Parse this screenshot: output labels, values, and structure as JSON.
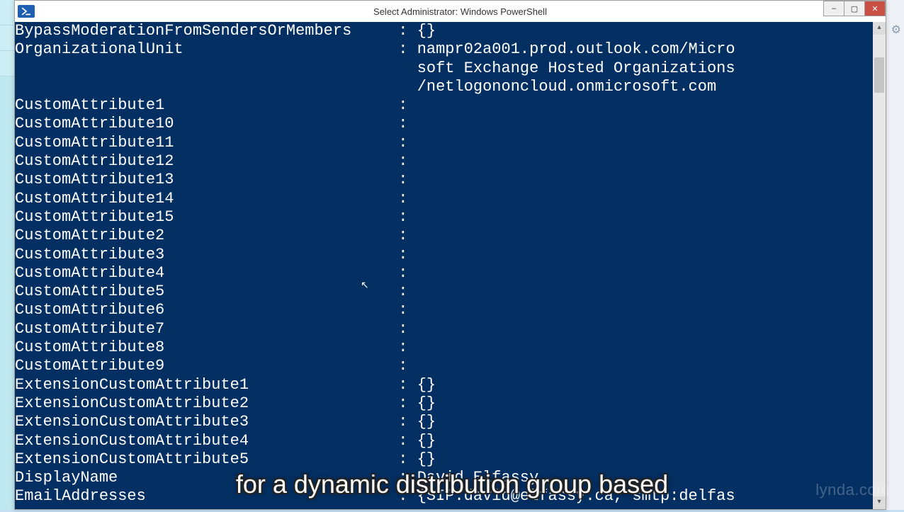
{
  "window": {
    "title": "Select Administrator: Windows PowerShell",
    "icon": "powershell-icon",
    "controls": {
      "minimize": "–",
      "maximize": "▢",
      "close": "✕"
    }
  },
  "console_rows": [
    {
      "key": "BypassModerationFromSendersOrMembers",
      "val": "{}"
    },
    {
      "key": "OrganizationalUnit",
      "val": "nampr02a001.prod.outlook.com/Micro"
    },
    {
      "key": "",
      "val": "soft Exchange Hosted Organizations"
    },
    {
      "key": "",
      "val": "/netlogononcloud.onmicrosoft.com"
    },
    {
      "key": "CustomAttribute1",
      "val": ""
    },
    {
      "key": "CustomAttribute10",
      "val": ""
    },
    {
      "key": "CustomAttribute11",
      "val": ""
    },
    {
      "key": "CustomAttribute12",
      "val": ""
    },
    {
      "key": "CustomAttribute13",
      "val": ""
    },
    {
      "key": "CustomAttribute14",
      "val": ""
    },
    {
      "key": "CustomAttribute15",
      "val": ""
    },
    {
      "key": "CustomAttribute2",
      "val": ""
    },
    {
      "key": "CustomAttribute3",
      "val": ""
    },
    {
      "key": "CustomAttribute4",
      "val": ""
    },
    {
      "key": "CustomAttribute5",
      "val": ""
    },
    {
      "key": "CustomAttribute6",
      "val": ""
    },
    {
      "key": "CustomAttribute7",
      "val": ""
    },
    {
      "key": "CustomAttribute8",
      "val": ""
    },
    {
      "key": "CustomAttribute9",
      "val": ""
    },
    {
      "key": "ExtensionCustomAttribute1",
      "val": "{}"
    },
    {
      "key": "ExtensionCustomAttribute2",
      "val": "{}"
    },
    {
      "key": "ExtensionCustomAttribute3",
      "val": "{}"
    },
    {
      "key": "ExtensionCustomAttribute4",
      "val": "{}"
    },
    {
      "key": "ExtensionCustomAttribute5",
      "val": "{}"
    },
    {
      "key": "DisplayName",
      "val": "David Elfassy"
    },
    {
      "key": "EmailAddresses",
      "val": "{SIP:david@elfassy.ca, smtp:delfas"
    }
  ],
  "console_key_col_width": 40,
  "colon_text": " : ",
  "caption": "for a dynamic distribution group based",
  "watermark": "lynda.com",
  "scroll": {
    "up": "▴",
    "down": "▾"
  }
}
